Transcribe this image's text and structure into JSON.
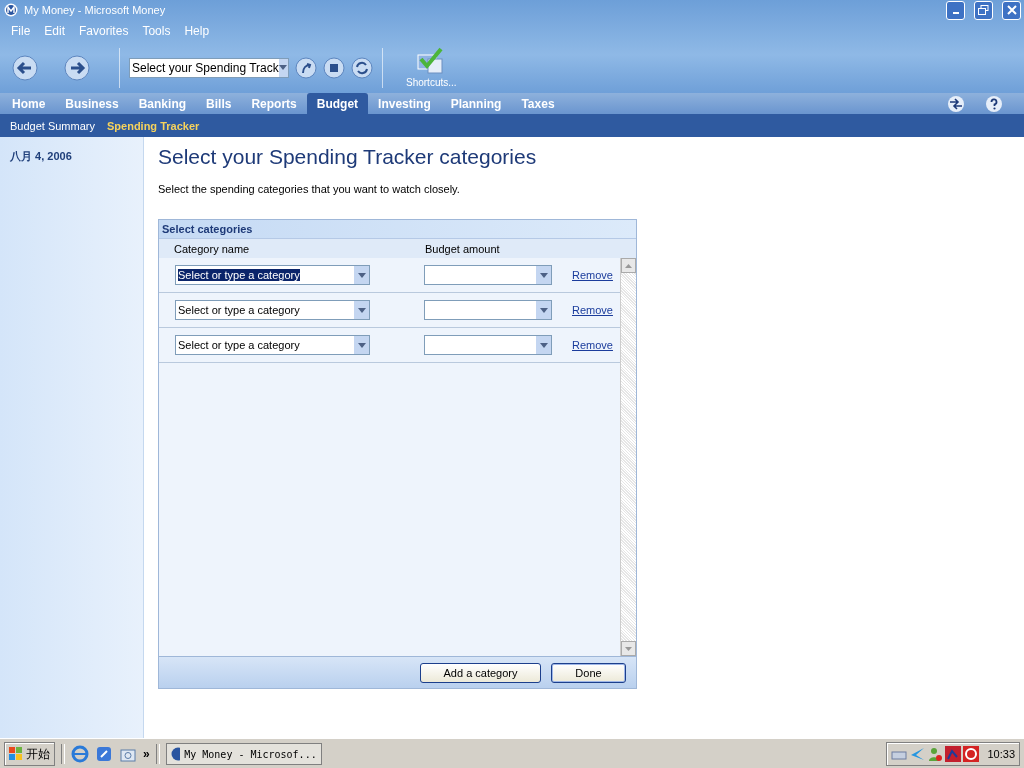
{
  "window": {
    "title": "My Money - Microsoft Money"
  },
  "menu": [
    "File",
    "Edit",
    "Favorites",
    "Tools",
    "Help"
  ],
  "toolbar": {
    "address": "Select your Spending Track",
    "shortcuts_label": "Shortcuts..."
  },
  "tabs": [
    {
      "label": "Home",
      "selected": false
    },
    {
      "label": "Business",
      "selected": false
    },
    {
      "label": "Banking",
      "selected": false
    },
    {
      "label": "Bills",
      "selected": false
    },
    {
      "label": "Reports",
      "selected": false
    },
    {
      "label": "Budget",
      "selected": true
    },
    {
      "label": "Investing",
      "selected": false
    },
    {
      "label": "Planning",
      "selected": false
    },
    {
      "label": "Taxes",
      "selected": false
    }
  ],
  "subtabs": [
    {
      "label": "Budget Summary",
      "selected": false
    },
    {
      "label": "Spending Tracker",
      "selected": true
    }
  ],
  "sidebar": {
    "date": "八月 4, 2006"
  },
  "page": {
    "title": "Select your Spending Tracker categories",
    "description": "Select the spending categories that you want to watch closely."
  },
  "panel": {
    "title": "Select categories",
    "columns": [
      "Category name",
      "Budget amount"
    ],
    "rows": [
      {
        "category": "Select or type a category",
        "text_selected": true,
        "remove": "Remove"
      },
      {
        "category": "Select or type a category",
        "text_selected": false,
        "remove": "Remove"
      },
      {
        "category": "Select or type a category",
        "text_selected": false,
        "remove": "Remove"
      }
    ],
    "buttons": [
      {
        "label": "Add a category",
        "kind": "normal"
      },
      {
        "label": "Done",
        "kind": "default"
      }
    ]
  },
  "taskbar": {
    "start": "开始",
    "task": "My Money - Microsof...",
    "more": "»",
    "clock": "10:33"
  }
}
